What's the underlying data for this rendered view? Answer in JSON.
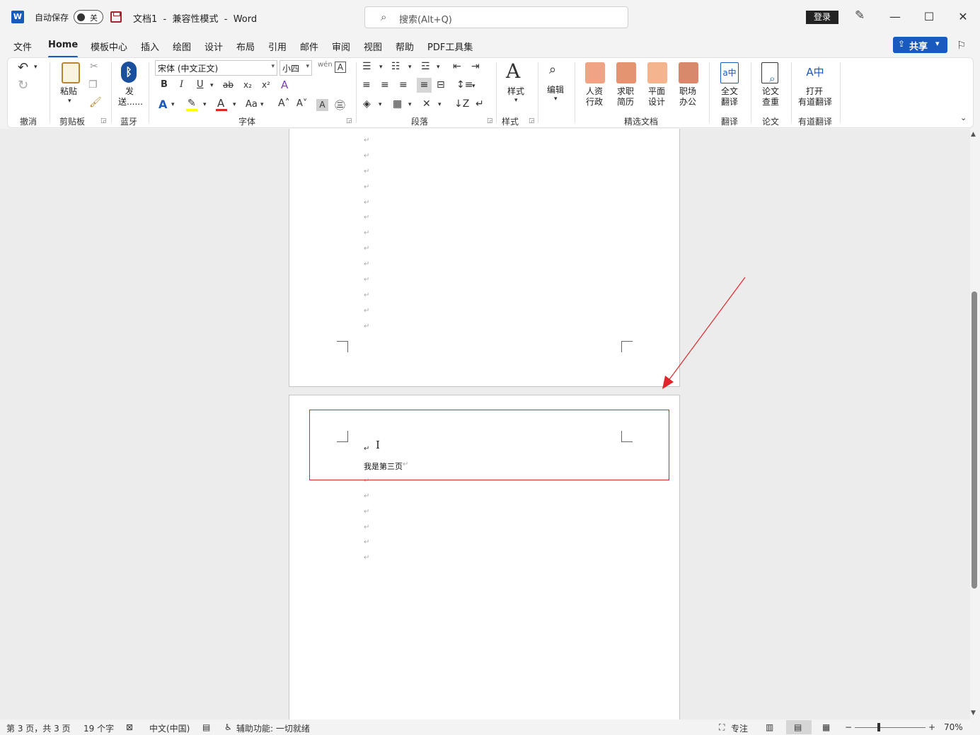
{
  "titlebar": {
    "app_icon": "W",
    "autosave_label": "自动保存",
    "autosave_state": "关",
    "doc_title": "文档1  -  兼容性模式  -  Word",
    "search_placeholder": "搜索(Alt+Q)",
    "login_label": "登录",
    "minimize": "—",
    "maximize": "☐",
    "close": "✕"
  },
  "menu": {
    "tabs": [
      "文件",
      "Home",
      "模板中心",
      "插入",
      "绘图",
      "设计",
      "布局",
      "引用",
      "邮件",
      "审阅",
      "视图",
      "帮助",
      "PDF工具集"
    ],
    "active_tab": "Home",
    "share_label": "共享"
  },
  "ribbon": {
    "groups": {
      "undo": "撤消",
      "clipboard": "剪贴板",
      "bluetooth": "蓝牙",
      "font": "字体",
      "paragraph": "段落",
      "styles": "样式",
      "featured_docs": "精选文档",
      "translate": "翻译",
      "thesis": "论文",
      "youdao": "有道翻译"
    },
    "paste_label": "粘贴",
    "send_label_1": "发",
    "send_label_2": "送......",
    "font_name": "宋体 (中文正文)",
    "font_size": "小四",
    "styles_label": "样式",
    "edit_label": "编辑",
    "hr_label_1": "人资",
    "hr_label_2": "行政",
    "resume_label_1": "求职",
    "resume_label_2": "简历",
    "design_label_1": "平面",
    "design_label_2": "设计",
    "office_label_1": "职场",
    "office_label_2": "办公",
    "fulltrans_label_1": "全文",
    "fulltrans_label_2": "翻译",
    "check_label_1": "论文",
    "check_label_2": "查重",
    "open_youdao_1": "打开",
    "open_youdao_2": "有道翻译",
    "colors": {
      "highlight": "#ffff00",
      "font_color": "#e0262b",
      "accent": "#185abd"
    }
  },
  "document": {
    "page3_text": "我是第三页",
    "para_mark": "↵",
    "annotation_color": "#e0262b"
  },
  "statusbar": {
    "page_info": "第 3 页，共 3 页",
    "word_count": "19 个字",
    "language": "中文(中国)",
    "accessibility": "辅助功能: 一切就绪",
    "focus": "专注",
    "zoom_minus": "−",
    "zoom_plus": "+",
    "zoom_level": "70%"
  }
}
